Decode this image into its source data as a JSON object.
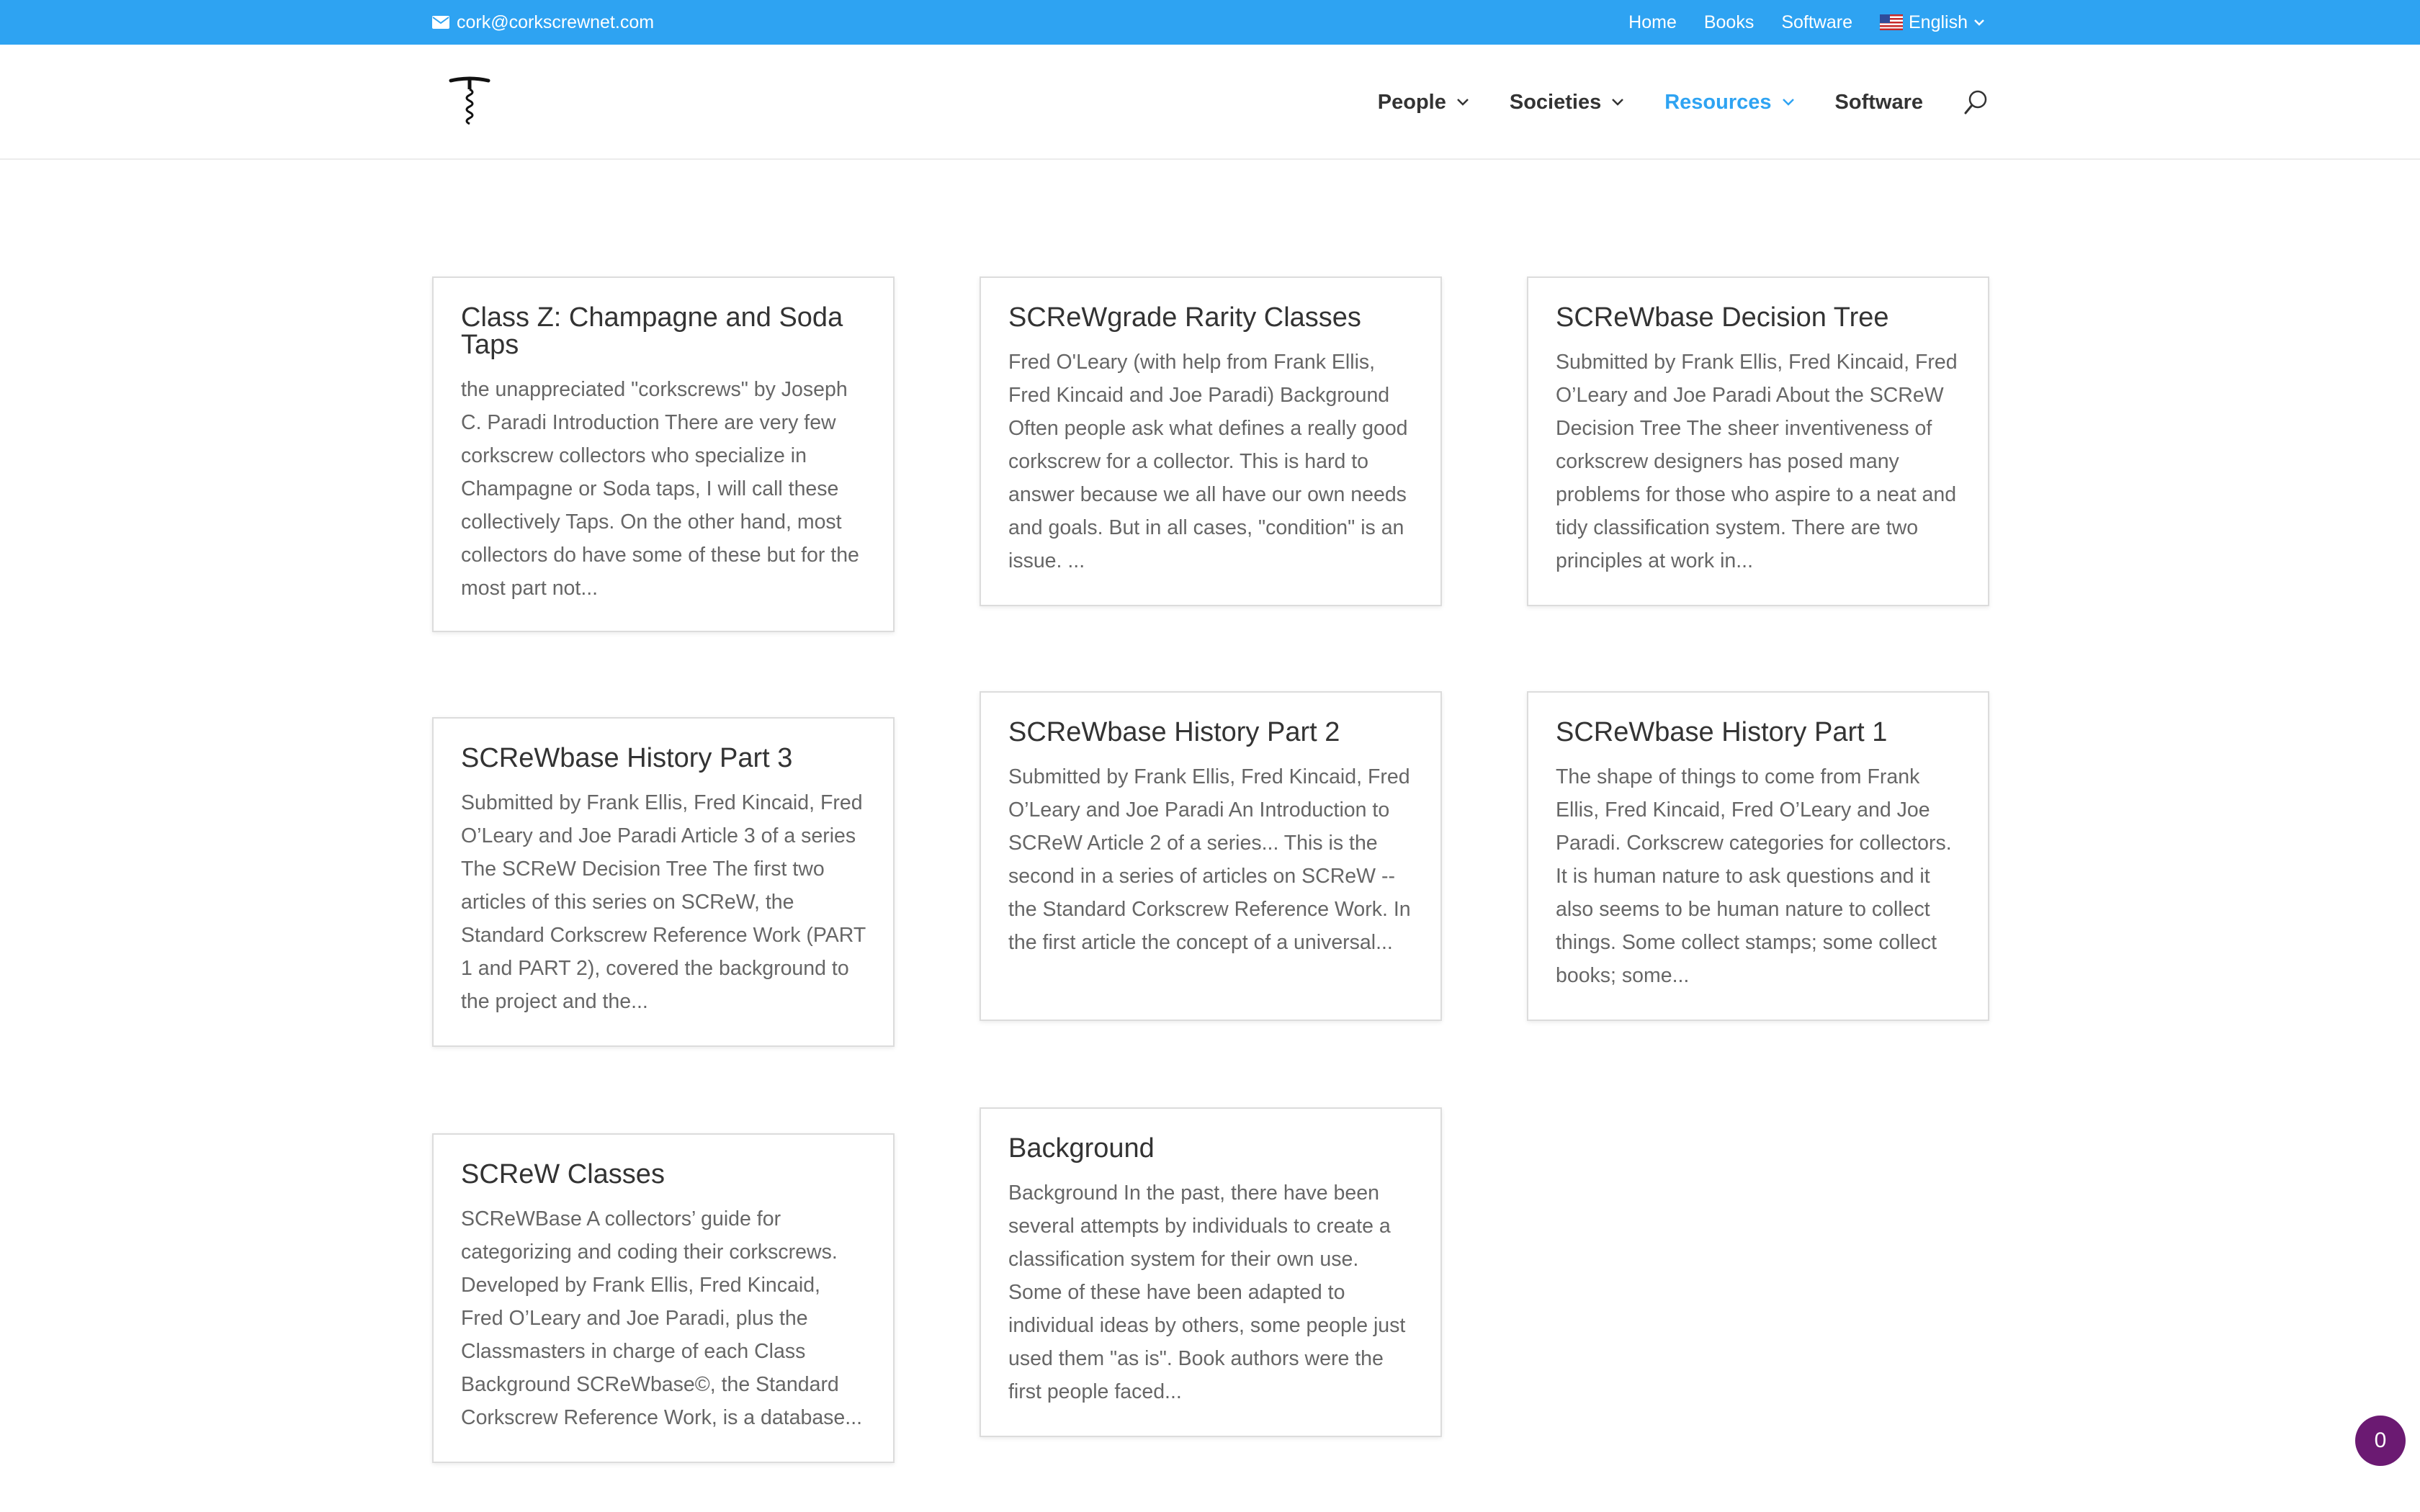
{
  "topbar": {
    "email": "cork@corkscrewnet.com",
    "links": [
      "Home",
      "Books",
      "Software"
    ],
    "language": "English"
  },
  "nav": {
    "items": [
      {
        "label": "People",
        "dropdown": true
      },
      {
        "label": "Societies",
        "dropdown": true
      },
      {
        "label": "Resources",
        "dropdown": true,
        "active": true
      },
      {
        "label": "Software",
        "dropdown": false
      }
    ]
  },
  "cards": [
    {
      "title": "Class Z: Champagne and Soda Taps",
      "excerpt": "the unappreciated \"corkscrews\" by Joseph C. Paradi Introduction There are very few corkscrew collectors who specialize in Champagne or Soda taps, I will call these collectively Taps.  On the other hand, most collectors do have some of these but for the most part not..."
    },
    {
      "title": "SCReWgrade Rarity Classes",
      "excerpt": "Fred O'Leary (with help from Frank Ellis, Fred Kincaid and Joe Paradi) Background Often people ask what defines a really good corkscrew for a collector.  This is hard to answer because we all have our own needs and goals.  But in all cases, \"condition\" is an issue. ..."
    },
    {
      "title": "SCReWbase Decision Tree",
      "excerpt": "Submitted by Frank Ellis, Fred Kincaid, Fred O’Leary and Joe Paradi About the SCReW Decision Tree The sheer inventiveness of corkscrew designers has posed many problems for those who aspire to a neat and tidy classification system.  There are two principles at work in..."
    },
    {
      "title": "SCReWbase History Part 3",
      "excerpt": "Submitted by Frank Ellis, Fred Kincaid, Fred O’Leary and Joe Paradi Article 3 of a series The SCReW Decision Tree The first two articles of this series on SCReW, the Standard Corkscrew Reference Work (PART 1 and PART 2), covered the background to the project and the..."
    },
    {
      "title": "SCReWbase History Part 2",
      "excerpt": "Submitted by Frank Ellis, Fred Kincaid, Fred O’Leary and Joe Paradi An Introduction to SCReW Article 2 of a series... This is the second in a series of articles on SCReW -- the Standard Corkscrew Reference Work. In the first article the concept of a universal..."
    },
    {
      "title": "SCReWbase History Part 1",
      "excerpt": "The shape of things to come from Frank Ellis, Fred Kincaid, Fred O’Leary and Joe Paradi. Corkscrew categories for collectors. It is human nature to ask questions and it also seems to be human nature to collect things. Some collect stamps; some collect books; some..."
    },
    {
      "title": "SCReW Classes",
      "excerpt": "SCReWBase A collectors’ guide for categorizing and coding their corkscrews. Developed by Frank Ellis, Fred Kincaid, Fred O’Leary and Joe Paradi, plus the Classmasters in charge of each Class Background SCReWbase©, the Standard Corkscrew Reference Work, is a database..."
    },
    {
      "title": "Background",
      "excerpt": "Background In the past, there have been several attempts by individuals to create a classification system for their own use.  Some of these have been adapted to individual ideas by others, some people just used them \"as is\".  Book authors were the first people faced..."
    }
  ],
  "cart": {
    "count": "0"
  },
  "colors": {
    "accent": "#2ea3f2",
    "cart": "#6b1a72"
  }
}
